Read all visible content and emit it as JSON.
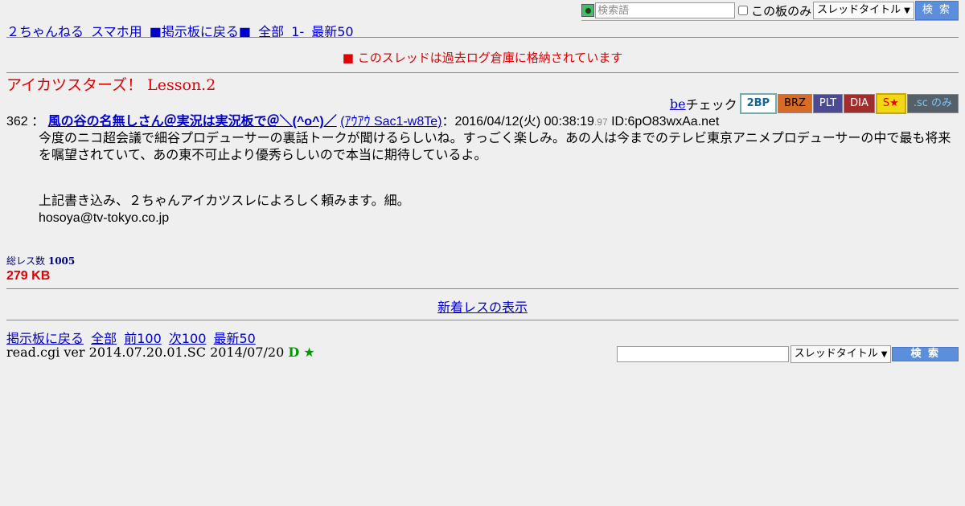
{
  "top_search": {
    "placeholder": "検索語",
    "board_only_label": "この板のみ",
    "select_value": "スレッドタイトル",
    "button_label": "検 索"
  },
  "nav_top": {
    "items": [
      "２ちゃんねる",
      "スマホ用",
      "■掲示板に戻る■",
      "全部",
      "1-",
      "最新50"
    ]
  },
  "notice": "■ このスレッドは過去ログ倉庫に格納されています",
  "thread_title": "アイカツスターズ！ Lesson.2",
  "be_check": {
    "be_link": "be",
    "label": "チェック",
    "tags": [
      "2BP",
      "BRZ",
      "PLT",
      "DIA",
      "S★",
      ".sc のみ"
    ]
  },
  "post": {
    "number": "362",
    "separator": "：",
    "name": "風の谷の名無しさん＠実況は実況板で＠＼(^o^)／",
    "trip": "(ｱｳｱｳ Sac1-w8Te)",
    "date": "：2016/04/12(火) 00:38:19",
    "date_ms": ".97",
    "id": "ID:6pO83wxAa.net",
    "body_line1": "今度のニコ超会議で細谷プロデューサーの裏話トークが聞けるらしいね。すっごく楽しみ。あの人は今までのテレビ東京アニメプロデューサーの中で最も将来を嘱望されていて、あの東不可止より優秀らしいので本当に期待しているよ。",
    "body_line2": "上記書き込み、２ちゃんアイカツスレによろしく頼みます。細。",
    "body_line3": "hosoya@tv-tokyo.co.jp"
  },
  "stats": {
    "count_label": "総レス数",
    "count_value": "1005",
    "size": "279 KB"
  },
  "new_res_link": "新着レスの表示",
  "nav_bottom": {
    "items": [
      "掲示板に戻る",
      "全部",
      "前100",
      "次100",
      "最新50"
    ]
  },
  "version": {
    "text": "read.cgi ver 2014.07.20.01.SC 2014/07/20",
    "d": "D",
    "star": "★"
  },
  "bottom_search": {
    "select_value": "スレッドタイトル",
    "button_label": "検 索"
  }
}
